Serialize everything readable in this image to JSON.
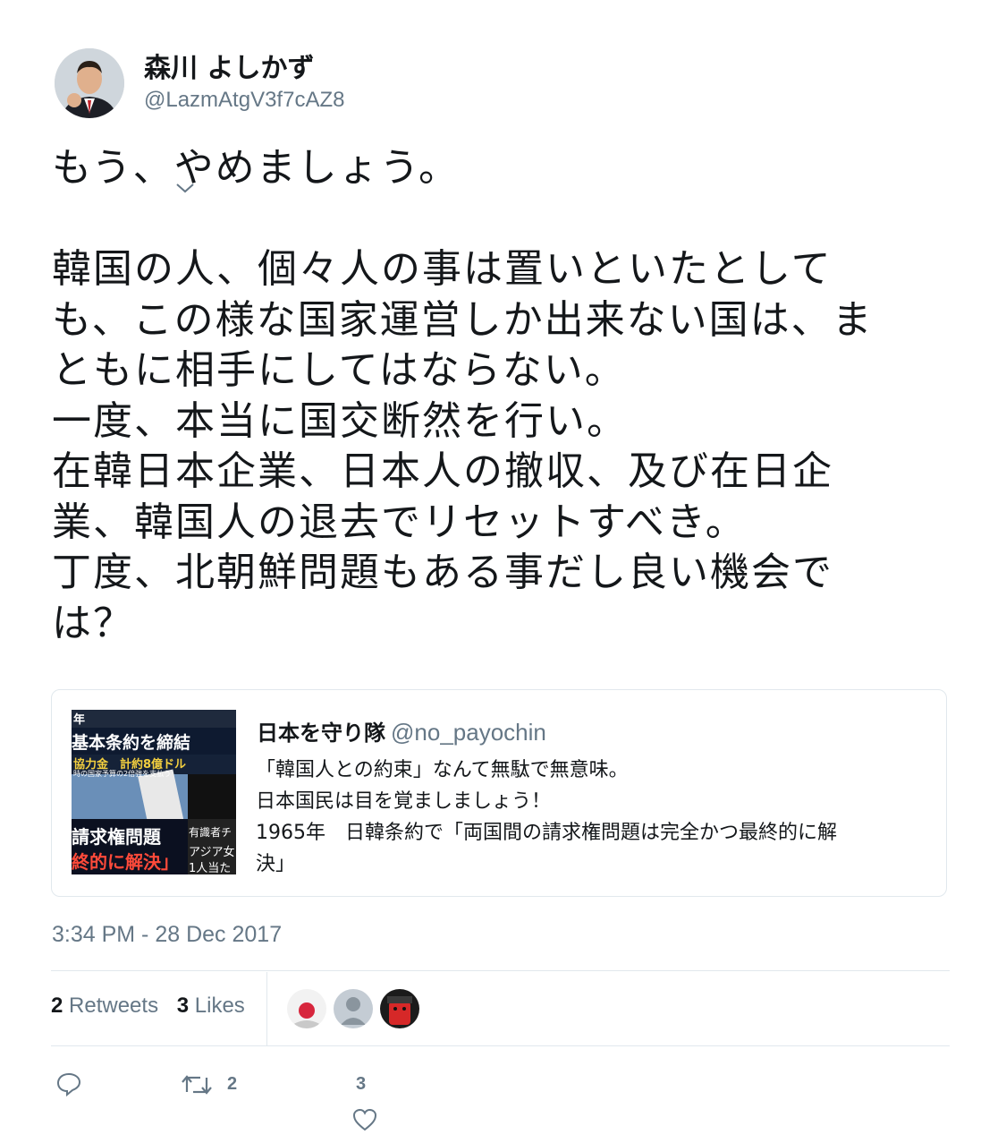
{
  "author": {
    "display_name": "森川 よしかず",
    "handle": "@LazmAtgV3f7cAZ8"
  },
  "tweet": {
    "lines": [
      "もう、やめましょう。",
      "",
      "韓国の人、個々人の事は置いといたとして",
      "も、この様な国家運営しか出来ない国は、ま",
      "ともに相手にしてはならない。",
      "一度、本当に国交断然を行い。",
      "在韓日本企業、日本人の撤収、及び在日企",
      "業、韓国人の退去でリセットすべき。",
      "丁度、北朝鮮問題もある事だし良い機会で",
      "は？"
    ]
  },
  "quote": {
    "name": "日本を守り隊",
    "handle": "@no_payochin",
    "lines": [
      "「韓国人との約束」なんて無駄で無意味。",
      "日本国民は目を覚ましましょう！",
      "1965年　日韓条約で「両国間の請求権問題は完全かつ最終的に解",
      "決」"
    ],
    "thumbnail_text": {
      "top_left": "年",
      "headline": "基本条約を締結",
      "subline": "協力金　計約8億ドル",
      "small": "時の国家予算の2倍強を支払う",
      "bottom1": "請求権問題",
      "bottom2": "終的に解決」",
      "side1": "有識者チ",
      "side2": "アジア女",
      "side3": "1人当た"
    }
  },
  "timestamp": "3:34 PM - 28 Dec 2017",
  "stats": {
    "retweets_count": "2",
    "retweets_label": "Retweets",
    "likes_count": "3",
    "likes_label": "Likes"
  },
  "actions": {
    "retweet_count": "2",
    "like_count": "3"
  },
  "colors": {
    "text": "#14171a",
    "secondary": "#657786",
    "border": "#e1e8ed"
  }
}
